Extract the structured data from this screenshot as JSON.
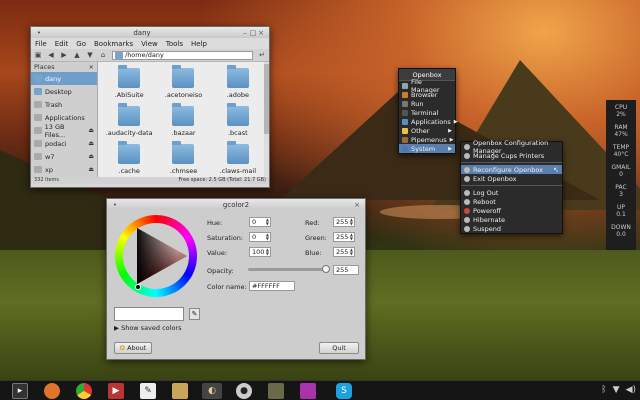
{
  "file_manager": {
    "title": "dany",
    "menu": [
      "File",
      "Edit",
      "Go",
      "Bookmarks",
      "View",
      "Tools",
      "Help"
    ],
    "path": "/home/dany",
    "sidebar_header": "Places",
    "places": [
      {
        "label": "dany",
        "icon": "home-folder-icon",
        "selected": true,
        "eject": false
      },
      {
        "label": "Desktop",
        "icon": "desktop-icon",
        "selected": false,
        "eject": false
      },
      {
        "label": "Trash",
        "icon": "trash-icon",
        "selected": false,
        "eject": false
      },
      {
        "label": "Applications",
        "icon": "applications-icon",
        "selected": false,
        "eject": false
      },
      {
        "label": "13 GB Files...",
        "icon": "drive-icon",
        "selected": false,
        "eject": true
      },
      {
        "label": "podaci",
        "icon": "drive-icon",
        "selected": false,
        "eject": true
      },
      {
        "label": "w7",
        "icon": "drive-icon",
        "selected": false,
        "eject": true
      },
      {
        "label": "xp",
        "icon": "drive-icon",
        "selected": false,
        "eject": true
      }
    ],
    "files": [
      ".AbiSuite",
      ".acetoneiso",
      ".adobe",
      ".audacity-data",
      ".bazaar",
      ".bcast",
      ".cache",
      ".chmsee",
      ".claws-mail"
    ],
    "status_left": "332 items",
    "status_right": "Free space: 2.5 GB (Total: 21.7 GB)"
  },
  "openbox_menu": {
    "title": "Openbox",
    "items": [
      {
        "label": "File Manager",
        "icon": "file-manager-icon",
        "submenu": false,
        "selected": false
      },
      {
        "label": "Browser",
        "icon": "browser-icon",
        "submenu": false,
        "selected": false
      },
      {
        "label": "Run",
        "icon": "run-icon",
        "submenu": false,
        "selected": false
      },
      {
        "label": "Terminal",
        "icon": "terminal-icon",
        "submenu": false,
        "selected": false
      },
      {
        "label": "Applications",
        "icon": "applications-icon",
        "submenu": true,
        "selected": false
      },
      {
        "label": "Other",
        "icon": "star-icon",
        "submenu": true,
        "selected": false
      },
      {
        "label": "Pipemenus",
        "icon": "pipemenus-icon",
        "submenu": true,
        "selected": false
      },
      {
        "label": "System",
        "icon": "system-icon",
        "submenu": true,
        "selected": true
      }
    ]
  },
  "system_menu": {
    "group1": [
      {
        "label": "Openbox Configuration Manager",
        "selected": false
      },
      {
        "label": "Manage Cups Printers",
        "selected": false
      }
    ],
    "group2": [
      {
        "label": "Reconfigure Openbox",
        "selected": true
      },
      {
        "label": "Exit Openbox",
        "selected": false
      }
    ],
    "group3": [
      {
        "label": "Log Out",
        "selected": false
      },
      {
        "label": "Reboot",
        "selected": false
      },
      {
        "label": "Poweroff",
        "selected": false
      },
      {
        "label": "Hibernate",
        "selected": false
      },
      {
        "label": "Suspend",
        "selected": false
      }
    ]
  },
  "conky": [
    {
      "label": "CPU",
      "value": "2%"
    },
    {
      "label": "RAM",
      "value": "47%"
    },
    {
      "label": "TEMP",
      "value": "40°C"
    },
    {
      "label": "GMAIL",
      "value": "0"
    },
    {
      "label": "PAC",
      "value": "3"
    },
    {
      "label": "UP",
      "value": "0.1"
    },
    {
      "label": "DOWN",
      "value": "0.0"
    }
  ],
  "gcolor": {
    "title": "gcolor2",
    "hue_label": "Hue:",
    "hue": "0",
    "sat_label": "Saturation:",
    "sat": "0",
    "val_label": "Value:",
    "val": "100",
    "red_label": "Red:",
    "red": "255",
    "green_label": "Green:",
    "green": "255",
    "blue_label": "Blue:",
    "blue": "255",
    "opacity_label": "Opacity:",
    "opacity": "255",
    "opacity_level": 1.0,
    "colorname_label": "Color name:",
    "colorname": "#FFFFFF",
    "show_saved": "Show saved colors",
    "about": "About",
    "quit": "Quit"
  },
  "taskbar": {
    "apps": [
      "terminal-icon",
      "firefox-icon",
      "chrome-icon",
      "media-icon",
      "text-editor-icon",
      "image-viewer-icon",
      "gcolor-icon",
      "obs-icon",
      "gimp-icon",
      "paint-icon",
      "skype-icon"
    ],
    "tray_icons": [
      "bluetooth-icon",
      "network-icon",
      "volume-icon"
    ]
  }
}
